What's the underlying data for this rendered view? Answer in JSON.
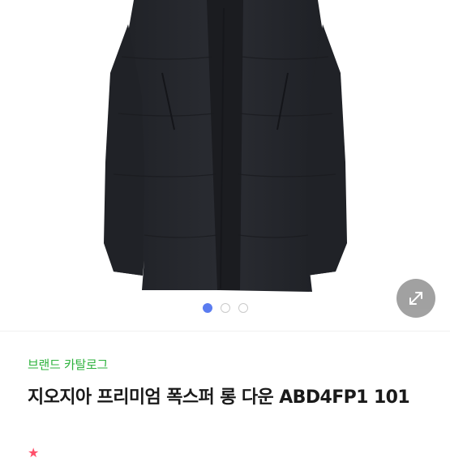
{
  "gallery": {
    "image": "black-long-down-coat-photo",
    "slides_total": 3,
    "active_slide": 1,
    "expand_icon": "expand-arrows-icon",
    "colors": {
      "active_dot": "#5b7cf0",
      "inactive_dot": "#c9c9c9",
      "coat": "#25272c"
    }
  },
  "product": {
    "catalog_link": "브랜드 카탈로그",
    "title": "지오지아 프리미엄 폭스퍼 롱 다운 ABD4FP1 101",
    "rating_icon": "star-icon",
    "accent_color": "#2eb33d"
  }
}
